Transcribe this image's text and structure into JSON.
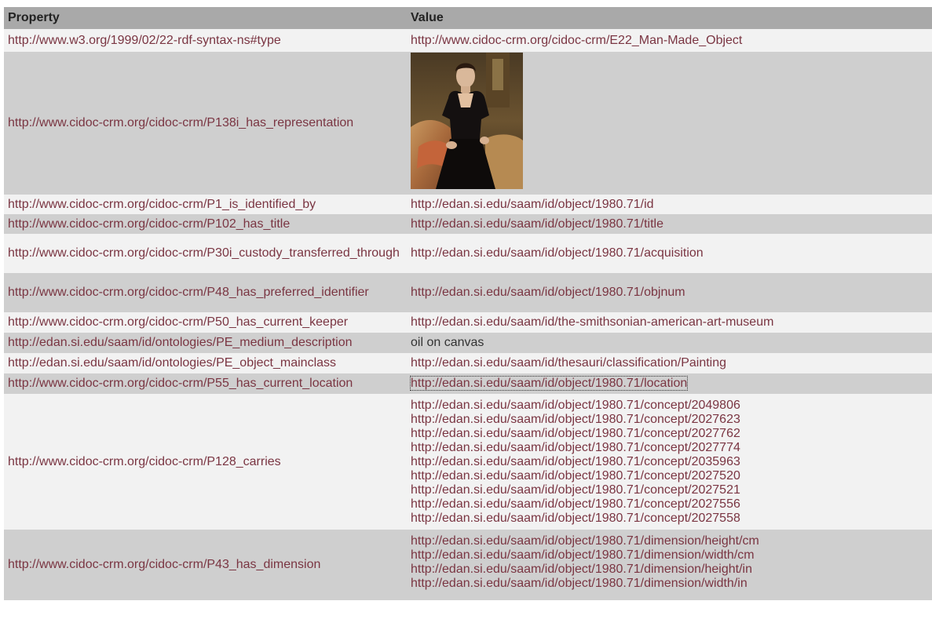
{
  "table": {
    "headers": {
      "property": "Property",
      "value": "Value"
    },
    "rows": [
      {
        "property": "http://www.w3.org/1999/02/22-rdf-syntax-ns#type",
        "value": "http://www.cidoc-crm.org/cidoc-crm/E22_Man-Made_Object"
      },
      {
        "property": "http://www.cidoc-crm.org/cidoc-crm/P138i_has_representation",
        "image": "portrait-painting"
      },
      {
        "property": "http://www.cidoc-crm.org/cidoc-crm/P1_is_identified_by",
        "value": "http://edan.si.edu/saam/id/object/1980.71/id"
      },
      {
        "property": "http://www.cidoc-crm.org/cidoc-crm/P102_has_title",
        "value": "http://edan.si.edu/saam/id/object/1980.71/title"
      },
      {
        "property": "http://www.cidoc-crm.org/cidoc-crm/P30i_custody_transferred_through",
        "value": "http://edan.si.edu/saam/id/object/1980.71/acquisition"
      },
      {
        "property": "http://www.cidoc-crm.org/cidoc-crm/P48_has_preferred_identifier",
        "value": "http://edan.si.edu/saam/id/object/1980.71/objnum"
      },
      {
        "property": "http://www.cidoc-crm.org/cidoc-crm/P50_has_current_keeper",
        "value": "http://edan.si.edu/saam/id/the-smithsonian-american-art-museum"
      },
      {
        "property": "http://edan.si.edu/saam/id/ontologies/PE_medium_description",
        "value": "oil on canvas"
      },
      {
        "property": "http://edan.si.edu/saam/id/ontologies/PE_object_mainclass",
        "value": "http://edan.si.edu/saam/id/thesauri/classification/Painting"
      },
      {
        "property": "http://www.cidoc-crm.org/cidoc-crm/P55_has_current_location",
        "value": "http://edan.si.edu/saam/id/object/1980.71/location"
      },
      {
        "property": "http://www.cidoc-crm.org/cidoc-crm/P128_carries",
        "values": [
          "http://edan.si.edu/saam/id/object/1980.71/concept/2049806",
          "http://edan.si.edu/saam/id/object/1980.71/concept/2027623",
          "http://edan.si.edu/saam/id/object/1980.71/concept/2027762",
          "http://edan.si.edu/saam/id/object/1980.71/concept/2027774",
          "http://edan.si.edu/saam/id/object/1980.71/concept/2035963",
          "http://edan.si.edu/saam/id/object/1980.71/concept/2027520",
          "http://edan.si.edu/saam/id/object/1980.71/concept/2027521",
          "http://edan.si.edu/saam/id/object/1980.71/concept/2027556",
          "http://edan.si.edu/saam/id/object/1980.71/concept/2027558"
        ]
      },
      {
        "property": "http://www.cidoc-crm.org/cidoc-crm/P43_has_dimension",
        "values": [
          "http://edan.si.edu/saam/id/object/1980.71/dimension/height/cm",
          "http://edan.si.edu/saam/id/object/1980.71/dimension/width/cm",
          "http://edan.si.edu/saam/id/object/1980.71/dimension/height/in",
          "http://edan.si.edu/saam/id/object/1980.71/dimension/width/in"
        ]
      }
    ]
  }
}
